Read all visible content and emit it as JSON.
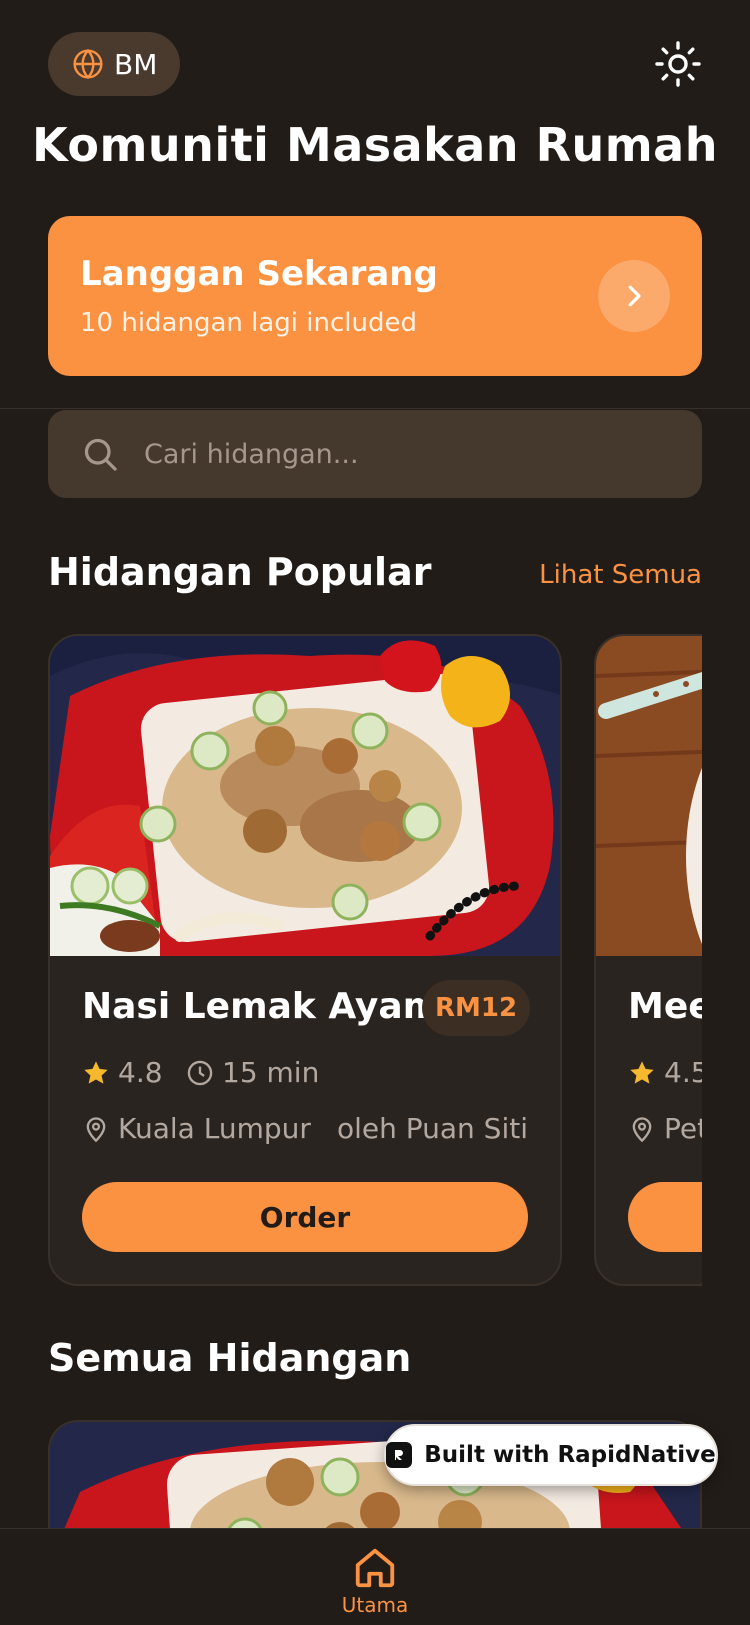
{
  "header": {
    "language_label": "BM",
    "title": "Komuniti Masakan Rumah"
  },
  "promo": {
    "title": "Langgan Sekarang",
    "subtitle": "10 hidangan lagi included"
  },
  "search": {
    "placeholder": "Cari hidangan..."
  },
  "popular": {
    "title": "Hidangan Popular",
    "see_all": "Lihat Semua",
    "cards": [
      {
        "name": "Nasi Lemak Ayam",
        "price": "RM12",
        "rating": "4.8",
        "time": "15 min",
        "location": "Kuala Lumpur",
        "cook": "oleh Puan Siti",
        "order_label": "Order"
      },
      {
        "name": "Mee",
        "rating": "4.5",
        "location": "Pet"
      }
    ]
  },
  "all_dishes": {
    "title": "Semua Hidangan"
  },
  "badge": {
    "label": "Built with RapidNative"
  },
  "tabbar": {
    "home_label": "Utama"
  },
  "colors": {
    "accent": "#fb9242",
    "background": "#221c18",
    "card": "#2a2420",
    "star": "#f5b82e"
  }
}
